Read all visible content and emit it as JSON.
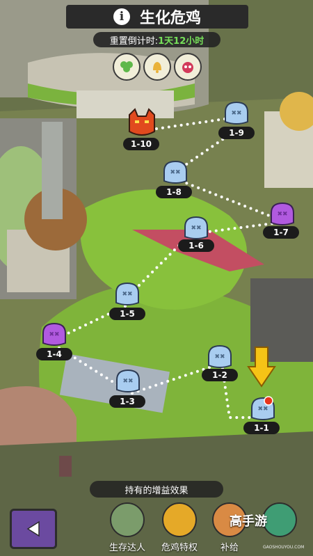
{
  "header": {
    "title": "生化危鸡",
    "reset_label": "重置倒计时:",
    "reset_value": "1天12小时"
  },
  "top_badges": [
    "clover-icon",
    "bell-icon",
    "monster-head-icon"
  ],
  "stages": [
    {
      "id": "1-10",
      "type": "boss-red"
    },
    {
      "id": "1-9",
      "type": "blue"
    },
    {
      "id": "1-8",
      "type": "blue"
    },
    {
      "id": "1-7",
      "type": "purple"
    },
    {
      "id": "1-6",
      "type": "blue"
    },
    {
      "id": "1-5",
      "type": "blue"
    },
    {
      "id": "1-4",
      "type": "purple"
    },
    {
      "id": "1-3",
      "type": "blue"
    },
    {
      "id": "1-2",
      "type": "blue"
    },
    {
      "id": "1-1",
      "type": "blue-current"
    }
  ],
  "buffs": {
    "header": "持有的增益效果",
    "items": [
      {
        "label": "生存达人",
        "icon": "zombie-chicken-icon"
      },
      {
        "label": "危鸡特权",
        "icon": "gold-card-icon"
      },
      {
        "label": "补给",
        "icon": "supply-icon"
      },
      {
        "label": "",
        "icon": "green-mascot-icon"
      }
    ]
  },
  "watermark": {
    "text": "高手游",
    "sub": "GAOSHOUYOU.COM"
  },
  "colors": {
    "blue_node": "#a9cdf0",
    "purple_node": "#b15adf",
    "boss_node": "#e14a1e",
    "arrow": "#f5c316"
  }
}
